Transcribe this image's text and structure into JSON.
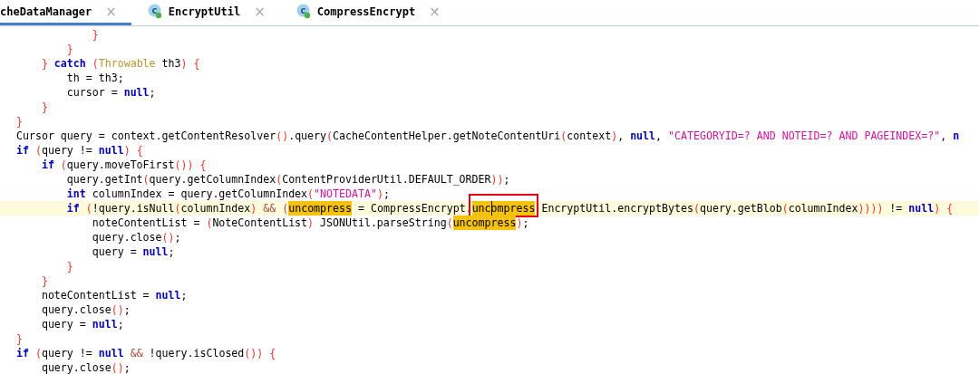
{
  "tabs": [
    {
      "label": "cheDataManager",
      "selected": true,
      "close": "×"
    },
    {
      "label": "EncryptUtil",
      "selected": false,
      "close": "×",
      "icon_letter": "c"
    },
    {
      "label": "CompressEncrypt",
      "selected": false,
      "close": "×",
      "icon_letter": "c"
    }
  ],
  "code_lines": [
    {
      "children": [
        {
          "children": [
            {
              "children": [
                {
                  "tokens": [
                    {
                      "kind": "p",
                      "text": "}"
                    }
                  ]
                }
              ]
            },
            {
              "tokens": [
                {
                  "kind": "p",
                  "text": "}"
                }
              ]
            }
          ]
        },
        {
          "tokens": [
            {
              "kind": "p",
              "text": "}"
            },
            {
              "kind": "kw",
              "text": " catch"
            },
            {
              "kind": "p",
              "text": " ("
            },
            {
              "kind": "type",
              "text": "Throwable"
            },
            {
              "kind": "t",
              "text": " th3"
            },
            {
              "kind": "p",
              "text": ") {"
            }
          ],
          "children": [
            {
              "tokens": [
                {
                  "kind": "t",
                  "text": "th = th3;"
                }
              ]
            },
            {
              "tokens": [
                {
                  "kind": "t",
                  "text": "cursor = "
                },
                {
                  "kind": "kw",
                  "text": "null"
                },
                {
                  "kind": "t",
                  "text": ";"
                }
              ]
            }
          ]
        },
        {
          "tokens": [
            {
              "kind": "p",
              "text": "}"
            }
          ]
        }
      ]
    },
    {
      "tokens": [
        {
          "kind": "p",
          "text": "}"
        }
      ]
    },
    {
      "tokens": [
        {
          "kind": "t",
          "text": "Cursor query = context.getContentResolver"
        },
        {
          "kind": "p",
          "text": "()"
        },
        {
          "kind": "t",
          "text": ".query"
        },
        {
          "kind": "p",
          "text": "("
        },
        {
          "kind": "t",
          "text": "CacheContentHelper.getNoteContentUri"
        },
        {
          "kind": "p",
          "text": "("
        },
        {
          "kind": "t",
          "text": "context"
        },
        {
          "kind": "p",
          "text": ")"
        },
        {
          "kind": "t",
          "text": ", "
        },
        {
          "kind": "kw",
          "text": "null"
        },
        {
          "kind": "t",
          "text": ", "
        },
        {
          "kind": "str",
          "text": "\"CATEGORYID=? AND NOTEID=? AND PAGEINDEX=?\""
        },
        {
          "kind": "t",
          "text": ", "
        },
        {
          "kind": "kw",
          "text": "n"
        }
      ]
    },
    {
      "tokens": [
        {
          "kind": "kw",
          "text": "if"
        },
        {
          "kind": "p",
          "text": " ("
        },
        {
          "kind": "t",
          "text": "query != "
        },
        {
          "kind": "kw",
          "text": "null"
        },
        {
          "kind": "p",
          "text": ") {"
        }
      ],
      "children": [
        {
          "tokens": [
            {
              "kind": "kw",
              "text": "if"
            },
            {
              "kind": "p",
              "text": " ("
            },
            {
              "kind": "t",
              "text": "query.moveToFirst"
            },
            {
              "kind": "p",
              "text": "()) {"
            }
          ],
          "children": [
            {
              "tokens": [
                {
                  "kind": "t",
                  "text": "query.getInt"
                },
                {
                  "kind": "p",
                  "text": "("
                },
                {
                  "kind": "t",
                  "text": "query.getColumnIndex"
                },
                {
                  "kind": "p",
                  "text": "("
                },
                {
                  "kind": "t",
                  "text": "ContentProviderUtil.DEFAULT_ORDER"
                },
                {
                  "kind": "p",
                  "text": "))"
                },
                {
                  "kind": "t",
                  "text": ";"
                }
              ]
            },
            {
              "tokens": [
                {
                  "kind": "kw",
                  "text": "int"
                },
                {
                  "kind": "t",
                  "text": " columnIndex = query.getColumnIndex"
                },
                {
                  "kind": "p",
                  "text": "("
                },
                {
                  "kind": "str",
                  "text": "\"NOTEDATA\""
                },
                {
                  "kind": "p",
                  "text": ")"
                },
                {
                  "kind": "t",
                  "text": ";"
                }
              ]
            },
            {
              "current": true,
              "tokens": [
                {
                  "kind": "kw",
                  "text": "if"
                },
                {
                  "kind": "p",
                  "text": " ("
                },
                {
                  "kind": "t",
                  "text": "!query.isNull"
                },
                {
                  "kind": "p",
                  "text": "("
                },
                {
                  "kind": "t",
                  "text": "columnIndex"
                },
                {
                  "kind": "p",
                  "text": ")"
                },
                {
                  "kind": "op",
                  "text": " &&"
                },
                {
                  "kind": "p",
                  "text": " ("
                },
                {
                  "kind": "match",
                  "text": "uncompress"
                },
                {
                  "kind": "t",
                  "text": " = CompressEncrypt."
                },
                {
                  "kind": "match",
                  "text": "uncompress",
                  "boxed": true,
                  "caret": true
                },
                {
                  "kind": "t",
                  "text": " EncryptUtil.encryptBytes"
                },
                {
                  "kind": "p",
                  "text": "("
                },
                {
                  "kind": "t",
                  "text": "query.getBlob"
                },
                {
                  "kind": "p",
                  "text": "("
                },
                {
                  "kind": "t",
                  "text": "columnIndex"
                },
                {
                  "kind": "p",
                  "text": "))))"
                },
                {
                  "kind": "t",
                  "text": " != "
                },
                {
                  "kind": "kw",
                  "text": "null"
                },
                {
                  "kind": "p",
                  "text": ") {"
                }
              ],
              "children": [
                {
                  "tokens": [
                    {
                      "kind": "t",
                      "text": "noteContentList = "
                    },
                    {
                      "kind": "p",
                      "text": "("
                    },
                    {
                      "kind": "t",
                      "text": "NoteContentList"
                    },
                    {
                      "kind": "p",
                      "text": ")"
                    },
                    {
                      "kind": "t",
                      "text": " JSONUtil.parseString"
                    },
                    {
                      "kind": "p",
                      "text": "("
                    },
                    {
                      "kind": "match",
                      "text": "uncompress"
                    },
                    {
                      "kind": "p",
                      "text": ")"
                    },
                    {
                      "kind": "t",
                      "text": ";"
                    }
                  ]
                },
                {
                  "tokens": [
                    {
                      "kind": "t",
                      "text": "query.close"
                    },
                    {
                      "kind": "p",
                      "text": "()"
                    },
                    {
                      "kind": "t",
                      "text": ";"
                    }
                  ]
                },
                {
                  "tokens": [
                    {
                      "kind": "t",
                      "text": "query = "
                    },
                    {
                      "kind": "kw",
                      "text": "null"
                    },
                    {
                      "kind": "t",
                      "text": ";"
                    }
                  ]
                }
              ]
            },
            {
              "tokens": [
                {
                  "kind": "p",
                  "text": "}"
                }
              ]
            }
          ]
        },
        {
          "tokens": [
            {
              "kind": "p",
              "text": "}"
            }
          ]
        },
        {
          "tokens": [
            {
              "kind": "t",
              "text": "noteContentList = "
            },
            {
              "kind": "kw",
              "text": "null"
            },
            {
              "kind": "t",
              "text": ";"
            }
          ]
        },
        {
          "tokens": [
            {
              "kind": "t",
              "text": "query.close"
            },
            {
              "kind": "p",
              "text": "()"
            },
            {
              "kind": "t",
              "text": ";"
            }
          ]
        },
        {
          "tokens": [
            {
              "kind": "t",
              "text": "query = "
            },
            {
              "kind": "kw",
              "text": "null"
            },
            {
              "kind": "t",
              "text": ";"
            }
          ]
        }
      ]
    },
    {
      "tokens": [
        {
          "kind": "p",
          "text": "}"
        }
      ]
    },
    {
      "tokens": [
        {
          "kind": "kw",
          "text": "if"
        },
        {
          "kind": "p",
          "text": " ("
        },
        {
          "kind": "t",
          "text": "query != "
        },
        {
          "kind": "kw",
          "text": "null"
        },
        {
          "kind": "op",
          "text": " &&"
        },
        {
          "kind": "t",
          "text": " !query.isClosed"
        },
        {
          "kind": "p",
          "text": "()) {"
        }
      ],
      "children": [
        {
          "tokens": [
            {
              "kind": "t",
              "text": "query.close"
            },
            {
              "kind": "p",
              "text": "()"
            },
            {
              "kind": "t",
              "text": ";"
            }
          ]
        }
      ]
    }
  ]
}
